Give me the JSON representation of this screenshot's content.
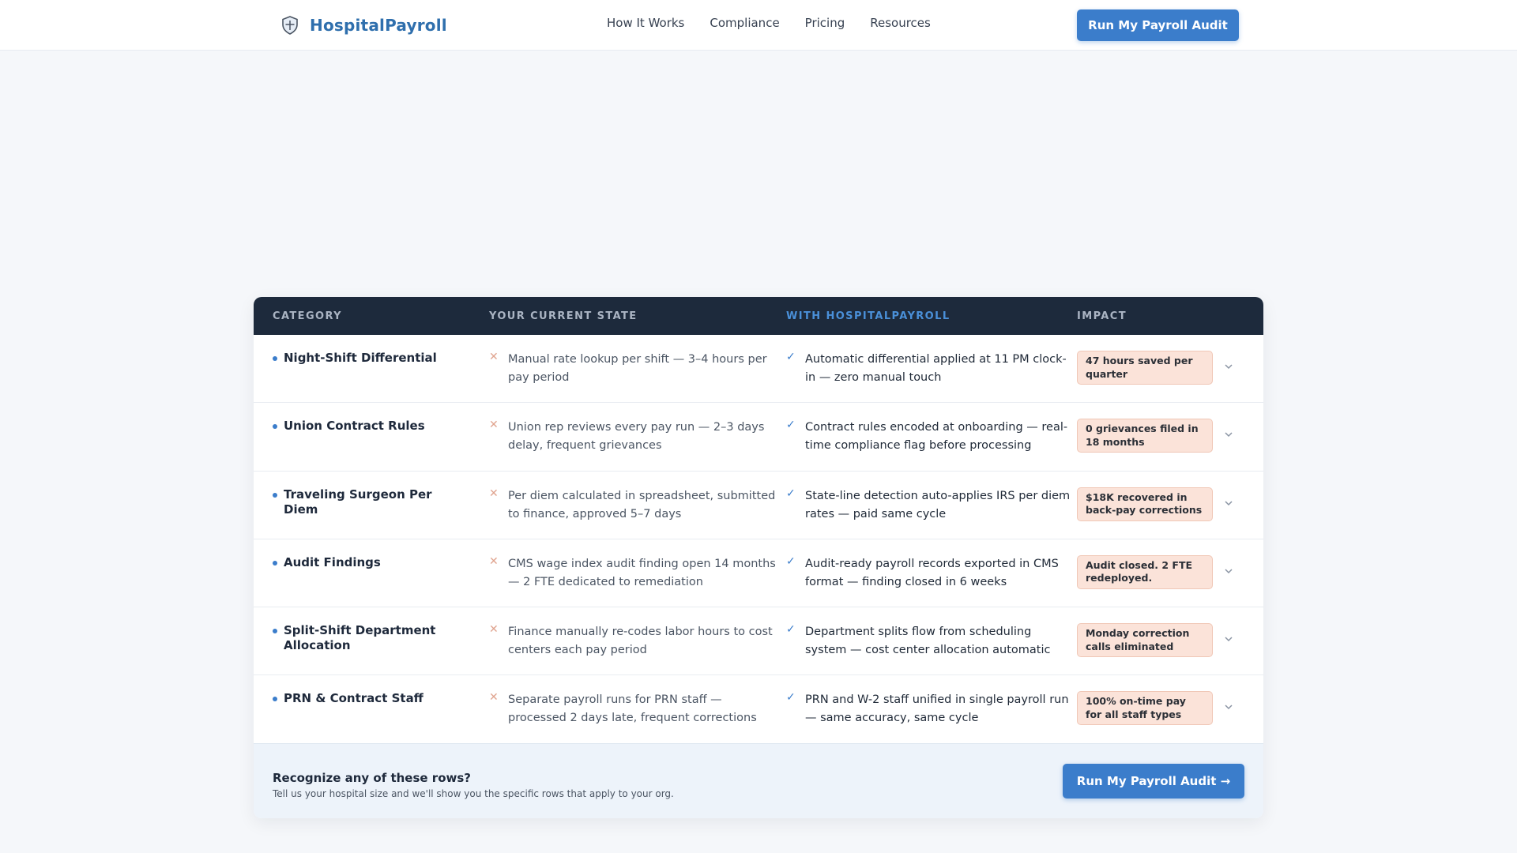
{
  "brand": {
    "name": "HospitalPayroll",
    "icon": "shield-icon",
    "color": "#2f6fad"
  },
  "nav": {
    "items": [
      "How It Works",
      "Compliance",
      "Pricing",
      "Resources"
    ]
  },
  "header_cta": "Run My Payroll Audit",
  "table": {
    "headers": {
      "category": "CATEGORY",
      "current": "YOUR CURRENT STATE",
      "with": "WITH HOSPITALPAYROLL",
      "impact": "IMPACT"
    },
    "rows": [
      {
        "category": "Night-Shift Differential",
        "current": "Manual rate lookup per shift — 3–4 hours per pay period",
        "with": "Automatic differential applied at 11 PM clock-in — zero manual touch",
        "impact": "47 hours saved per quarter"
      },
      {
        "category": "Union Contract Rules",
        "current": "Union rep reviews every pay run — 2–3 days delay, frequent grievances",
        "with": "Contract rules encoded at onboarding — real-time compliance flag before processing",
        "impact": "0 grievances filed in 18 months"
      },
      {
        "category": "Traveling Surgeon Per Diem",
        "current": "Per diem calculated in spreadsheet, submitted to finance, approved 5–7 days",
        "with": "State-line detection auto-applies IRS per diem rates — paid same cycle",
        "impact": "$18K recovered in back-pay corrections"
      },
      {
        "category": "Audit Findings",
        "current": "CMS wage index audit finding open 14 months — 2 FTE dedicated to remediation",
        "with": "Audit-ready payroll records exported in CMS format — finding closed in 6 weeks",
        "impact": "Audit closed. 2 FTE redeployed."
      },
      {
        "category": "Split-Shift Department Allocation",
        "current": "Finance manually re-codes labor hours to cost centers each pay period",
        "with": "Department splits flow from scheduling system — cost center allocation automatic",
        "impact": "Monday correction calls eliminated"
      },
      {
        "category": "PRN & Contract Staff",
        "current": "Separate payroll runs for PRN staff — processed 2 days late, frequent corrections",
        "with": "PRN and W-2 staff unified in single payroll run — same accuracy, same cycle",
        "impact": "100% on-time pay for all staff types"
      }
    ]
  },
  "footer": {
    "title": "Recognize any of these rows?",
    "subtitle": "Tell us your hospital size and we'll show you the specific rows that apply to your org.",
    "cta": "Run My Payroll Audit →"
  },
  "colors": {
    "accent": "#3b7dcb",
    "table_header_bg": "#1d2a3c",
    "badge_bg": "#fbe3d9"
  }
}
